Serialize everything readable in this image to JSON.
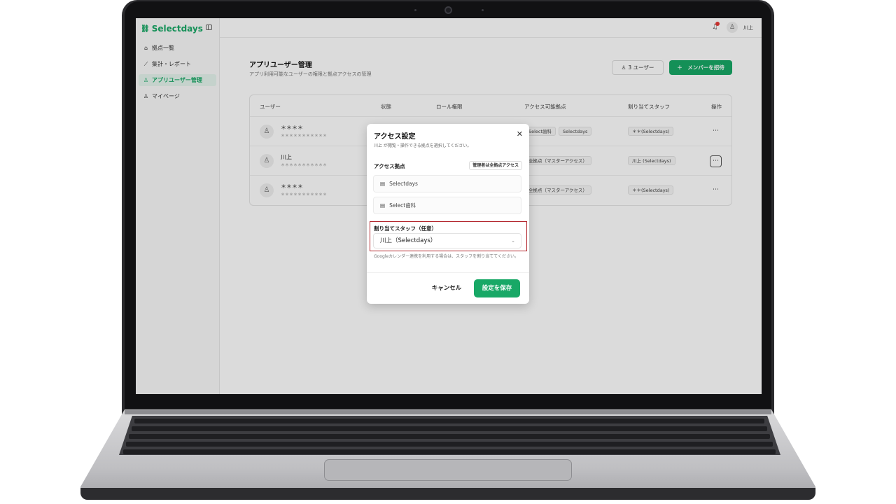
{
  "app": {
    "brand": "Selectdays",
    "brand_icon": "link-icon"
  },
  "sidebar": {
    "items": [
      {
        "label": "拠点一覧",
        "icon": "store-icon",
        "active": false
      },
      {
        "label": "集計・レポート",
        "icon": "chart-icon",
        "active": false
      },
      {
        "label": "アプリユーザー管理",
        "icon": "users-icon",
        "active": true
      },
      {
        "label": "マイページ",
        "icon": "user-settings-icon",
        "active": false
      }
    ]
  },
  "topbar": {
    "user_name": "川上",
    "notification": true
  },
  "page": {
    "title": "アプリユーザー管理",
    "subtitle": "アプリ利用可能なユーザーの権限と拠点アクセスの管理",
    "user_count": "3 ユーザー",
    "invite_label": "＋　メンバーを招待"
  },
  "table": {
    "headers": [
      "ユーザー",
      "状態",
      "ロール権限",
      "アクセス可能拠点",
      "割り当てスタッフ",
      "操作"
    ],
    "rows": [
      {
        "name": "＊＊＊＊",
        "email": "＊＊＊＊＊＊＊＊＊＊＊",
        "access": [
          "Select歯科",
          "Selectdays"
        ],
        "staff": "＊＊(Selectdays)"
      },
      {
        "name": "川上",
        "email": "＊＊＊＊＊＊＊＊＊＊＊",
        "access": [
          "全拠点（マスターアクセス）"
        ],
        "staff": "川上 (Selectdays)"
      },
      {
        "name": "＊＊＊＊",
        "email": "＊＊＊＊＊＊＊＊＊＊＊",
        "access": [
          "全拠点（マスターアクセス）"
        ],
        "staff": "＊＊(Selectdays)"
      }
    ]
  },
  "modal": {
    "title": "アクセス設定",
    "description": "川上 が閲覧・操作できる拠点を選択してください。",
    "access_label": "アクセス拠点",
    "admin_badge": "管理者は全拠点アクセス",
    "locations": [
      "Selectdays",
      "Select歯科"
    ],
    "staff_label": "割り当てスタッフ（任意）",
    "staff_value": "川上（Selectdays）",
    "staff_hint": "Googleカレンダー連携を利用する場合は、スタッフを割り当ててください。",
    "cancel_label": "キャンセル",
    "save_label": "設定を保存"
  },
  "colors": {
    "accent": "#18a866",
    "highlight": "#b3262d",
    "notification": "#e53935"
  }
}
